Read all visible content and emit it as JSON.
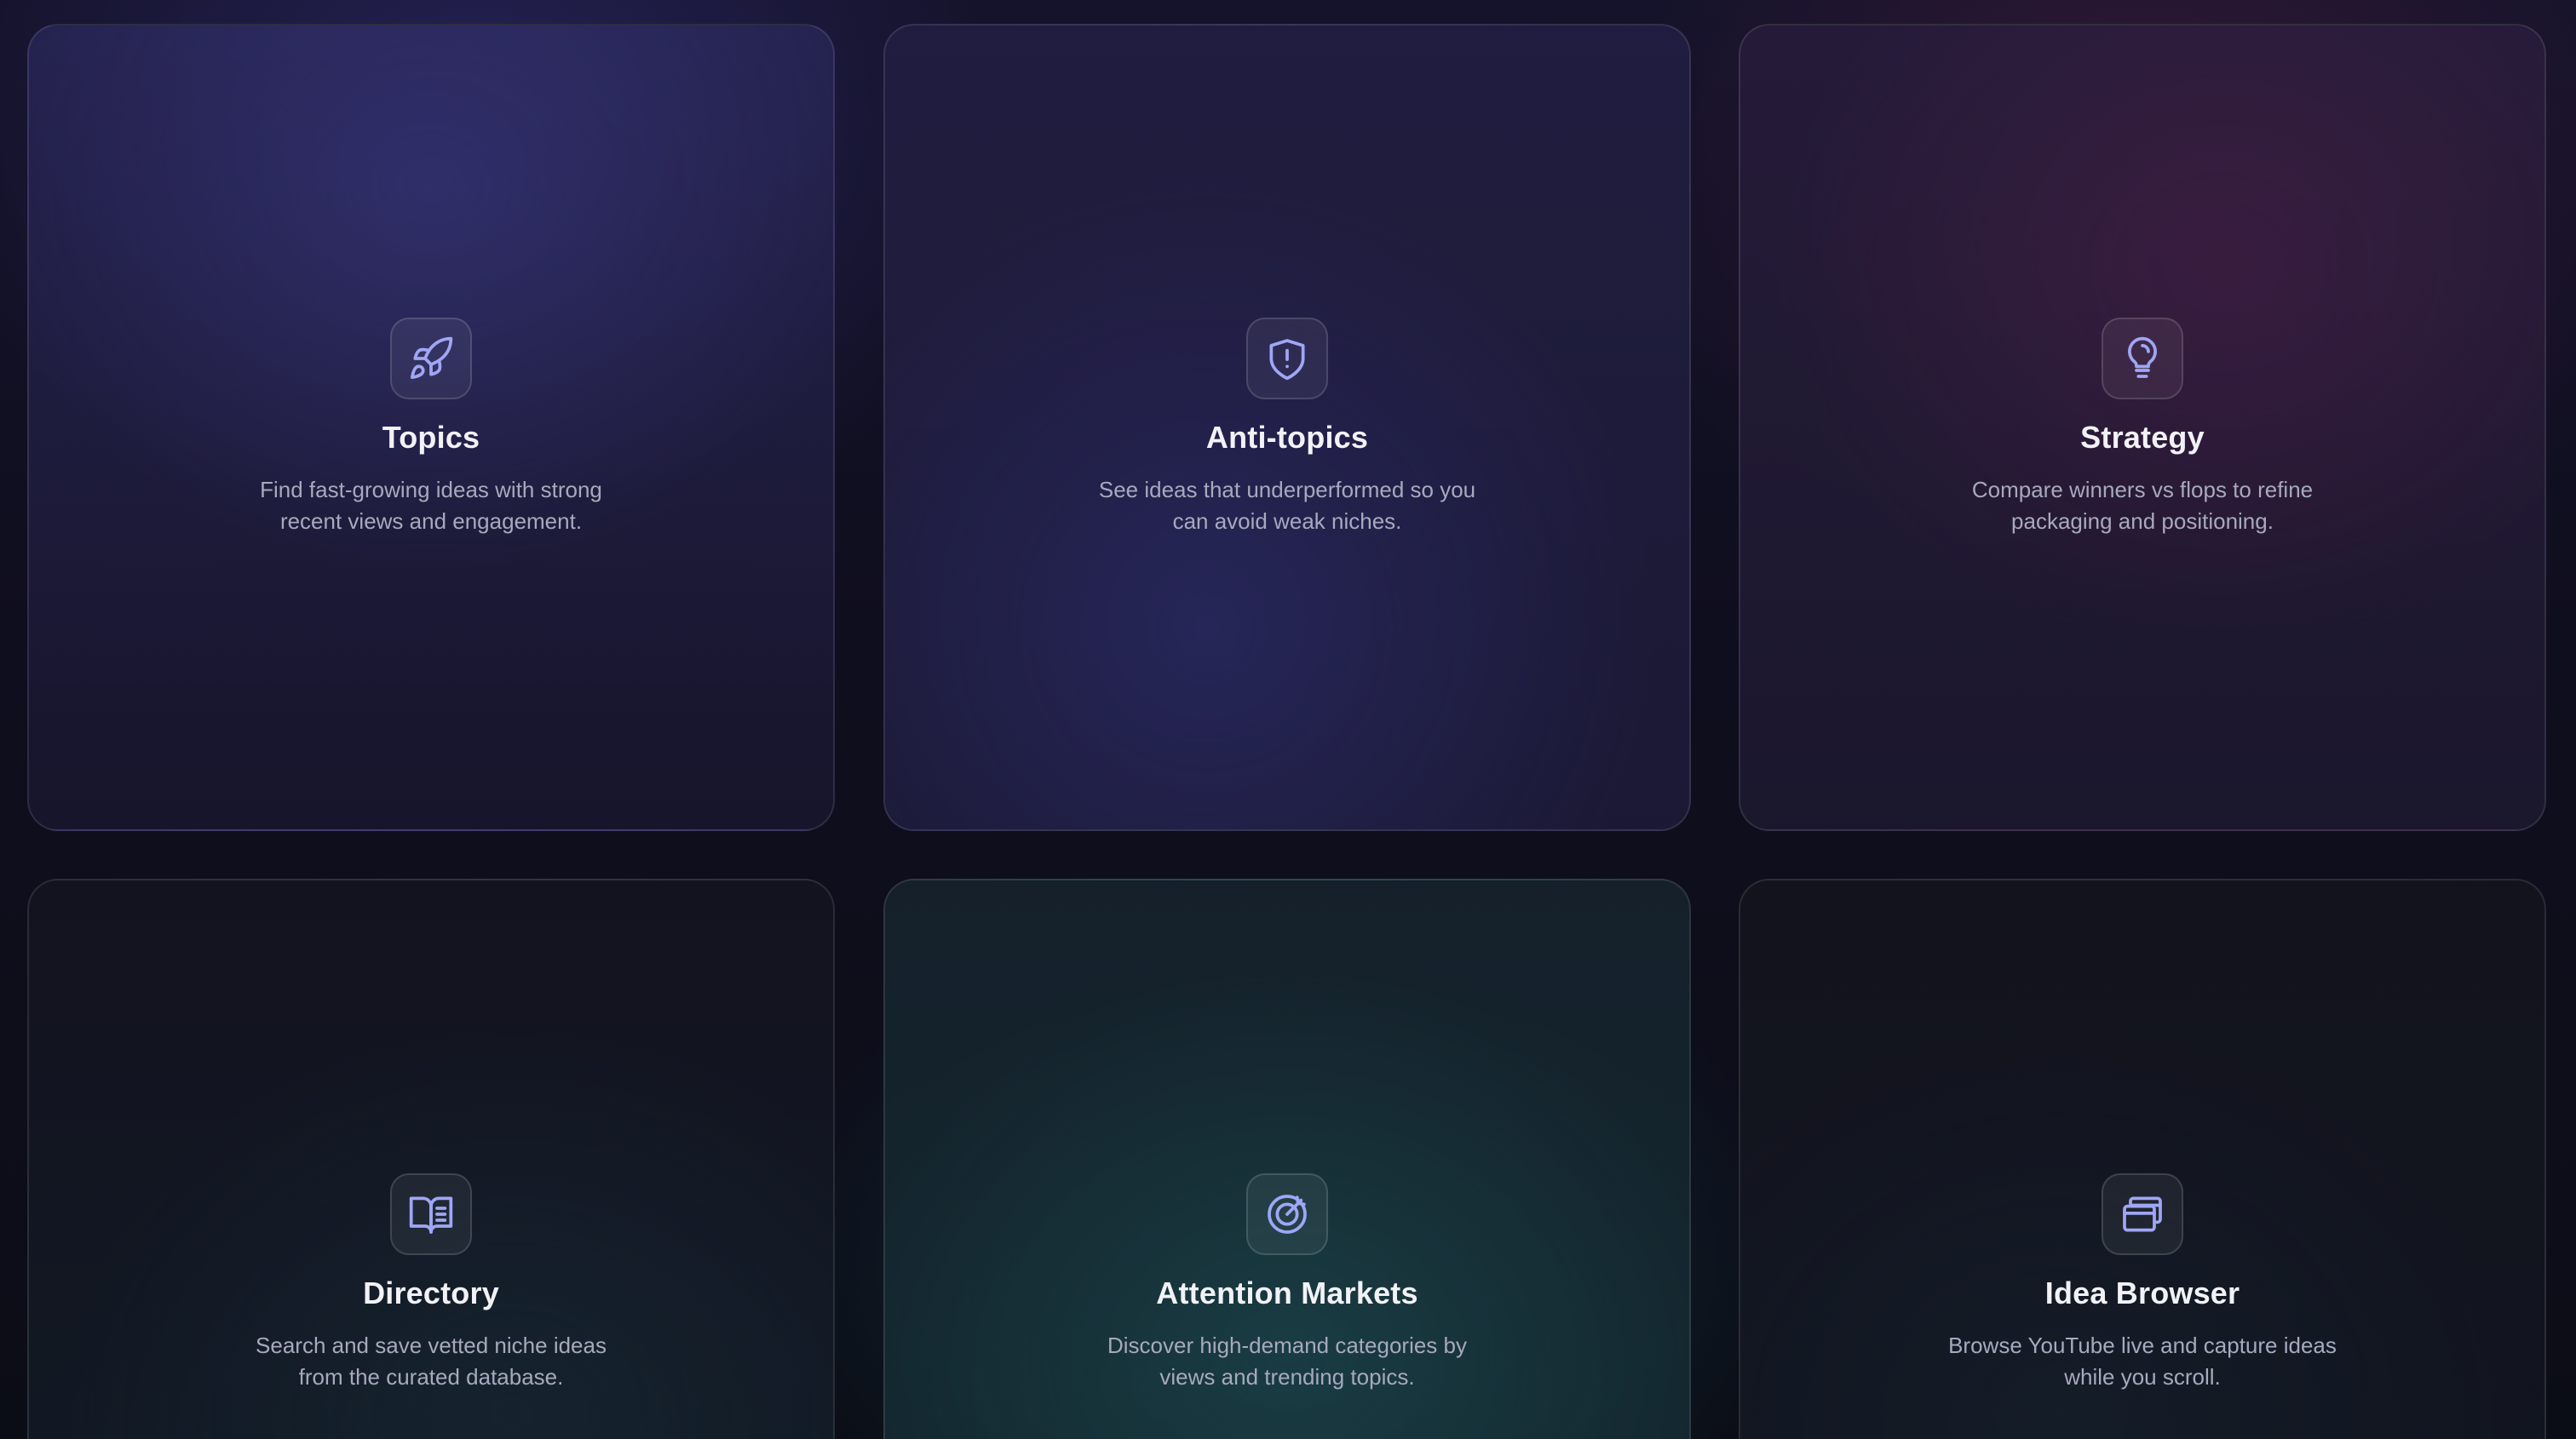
{
  "cards": [
    {
      "title": "Topics",
      "description": "Find fast-growing ideas with strong recent views and engagement.",
      "icon": "rocket-icon"
    },
    {
      "title": "Anti-topics",
      "description": "See ideas that underperformed so you can avoid weak niches.",
      "icon": "shield-alert-icon"
    },
    {
      "title": "Strategy",
      "description": "Compare winners vs flops to refine packaging and positioning.",
      "icon": "lightbulb-icon"
    },
    {
      "title": "Directory",
      "description": "Search and save vetted niche ideas from the curated database.",
      "icon": "book-open-icon"
    },
    {
      "title": "Attention Markets",
      "description": "Discover high-demand categories by views and trending topics.",
      "icon": "target-icon"
    },
    {
      "title": "Idea Browser",
      "description": "Browse YouTube live and capture ideas while you scroll.",
      "icon": "browser-windows-icon"
    }
  ],
  "colors": {
    "icon_stroke": "#9fa6f6",
    "title_text": "#f2f2f6",
    "description_text": "#a7a9bd"
  }
}
